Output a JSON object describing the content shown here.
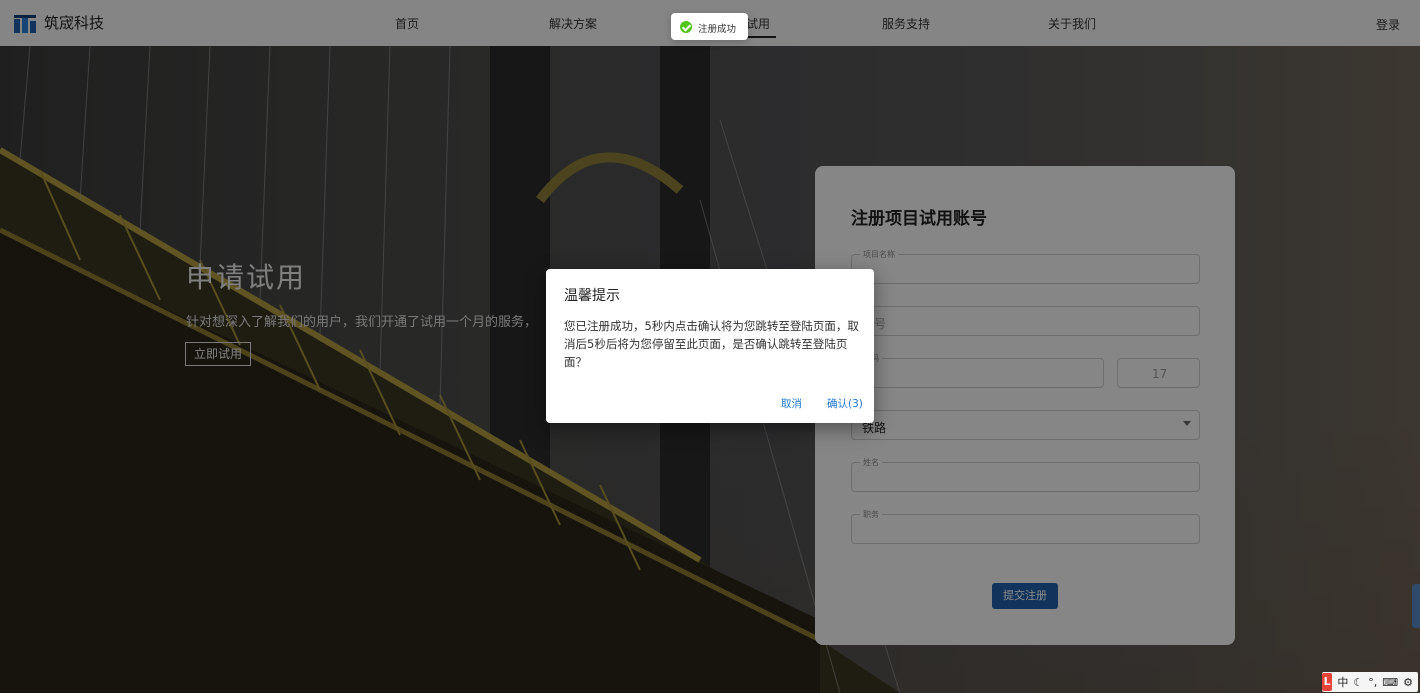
{
  "brand": {
    "name": "筑宬科技"
  },
  "nav": {
    "items": [
      "首页",
      "解决方案",
      "申请试用",
      "服务支持",
      "关于我们"
    ],
    "login": "登录"
  },
  "toast": {
    "text": "注册成功",
    "icon": "check-circle-icon",
    "color": "#52c41a"
  },
  "hero": {
    "title": "申请试用",
    "description": "针对想深入了解我们的用户，我们开通了试用一个月的服务，",
    "button": "立即试用"
  },
  "form": {
    "title": "注册项目试用账号",
    "fields": [
      {
        "label": "项目名称",
        "placeholder": "",
        "value": ""
      },
      {
        "label": "",
        "placeholder": "机号",
        "value": ""
      },
      {
        "label": "证码",
        "placeholder": "",
        "value": ""
      },
      {
        "label": "",
        "placeholder": "",
        "value": "铁路"
      },
      {
        "label": "姓名",
        "placeholder": "",
        "value": ""
      },
      {
        "label": "职务",
        "placeholder": "",
        "value": ""
      }
    ],
    "captcha_text": "17",
    "submit": "提交注册"
  },
  "dialog": {
    "title": "温馨提示",
    "body": "您已注册成功，5秒内点击确认将为您跳转至登陆页面，取消后5秒后将为您停留至此页面，是否确认跳转至登陆页面？",
    "cancel": "取消",
    "confirm": "确认(3)"
  },
  "ime": {
    "logo": "L",
    "lang": "中",
    "icons": [
      "moon-icon",
      "punct-icon",
      "keyboard-icon",
      "gear-icon"
    ]
  },
  "colors": {
    "accent": "#1f5ea8",
    "link": "#1f78d1",
    "ime": "#e8433a"
  }
}
